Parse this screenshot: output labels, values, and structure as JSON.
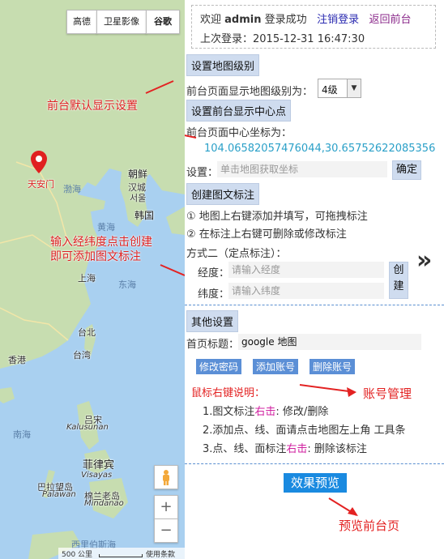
{
  "map": {
    "type_buttons": [
      "高德",
      "卫星影像",
      "谷歌"
    ],
    "labels": {
      "tiananmen": "天安门",
      "bohai": "渤海",
      "chaoxian": "朝鲜",
      "hancheng": "汉城",
      "shouer": "서울",
      "hanguo": "韩国",
      "huanghai": "黄海",
      "shanghai": "上海",
      "donghai": "东海",
      "taibei": "台北",
      "taiwan": "台湾",
      "xianggang": "香港",
      "nanhai": "南海",
      "lvsong": "吕宋",
      "kalusunan": "Kalusunan",
      "feilvbin": "菲律宾",
      "visayas": "Visayas",
      "balawang": "巴拉望岛",
      "palawan": "Palawan",
      "minlanlao": "棉兰老岛",
      "mindanao": "Mindanao",
      "xiliboshai": "西里伯斯海"
    },
    "zoom_in": "+",
    "zoom_out": "−",
    "scale": "500 公里",
    "terms": "使用条款",
    "colors": {
      "sea": "#a9d0f0",
      "land": "#c7ddb0",
      "pin": "#e02020"
    }
  },
  "panel": {
    "user": {
      "welcome": "欢迎",
      "username": "admin",
      "login_ok": "登录成功",
      "logout": "注销登录",
      "back": "返回前台",
      "last_login_label": "上次登录：",
      "last_login": "2015-12-31 16:47:30"
    },
    "level": {
      "button": "设置地图级别",
      "label": "前台页面显示地图级别为：",
      "select_value": "4级"
    },
    "center": {
      "button": "设置前台显示中心点",
      "label": "前台页面中心坐标为：",
      "coords": "104.06582057476044,30.65752622085356",
      "set_label": "设置：",
      "placeholder": "单击地图获取坐标",
      "confirm": "确定"
    },
    "marker": {
      "button": "创建图文标注",
      "tip1": "① 地图上右键添加并填写，可拖拽标注",
      "tip2": "② 在标注上右键可删除或修改标注",
      "method2": "方式二（定点标注）：",
      "lng_label": "经度：",
      "lng_placeholder": "请输入经度",
      "lat_label": "纬度：",
      "lat_placeholder": "请输入纬度",
      "create_1": "创",
      "create_2": "建"
    },
    "other": {
      "button": "其他设置",
      "title_label": "首页标题：",
      "title_value": "google 地图",
      "change_pwd": "修改密码",
      "add_account": "添加账号",
      "delete_account": "删除账号"
    },
    "help": {
      "title": "鼠标右键说明：",
      "item1_a": "1.图文标注",
      "item1_hl": "右击",
      "item1_b": ": 修改/删除",
      "item2": "2.添加点、线、面请点击地图左上角 工具条",
      "item3_a": "3.点、线、面标注",
      "item3_hl": "右击",
      "item3_b": ": 删除该标注"
    },
    "preview": "效果预览"
  },
  "annotations": {
    "default_display": "前台默认显示设置",
    "input_coords_1": "输入经纬度点击创建",
    "input_coords_2": "即可添加图文标注",
    "account_mgmt": "账号管理",
    "preview_front": "预览前台页"
  },
  "expand_arrow": "»"
}
